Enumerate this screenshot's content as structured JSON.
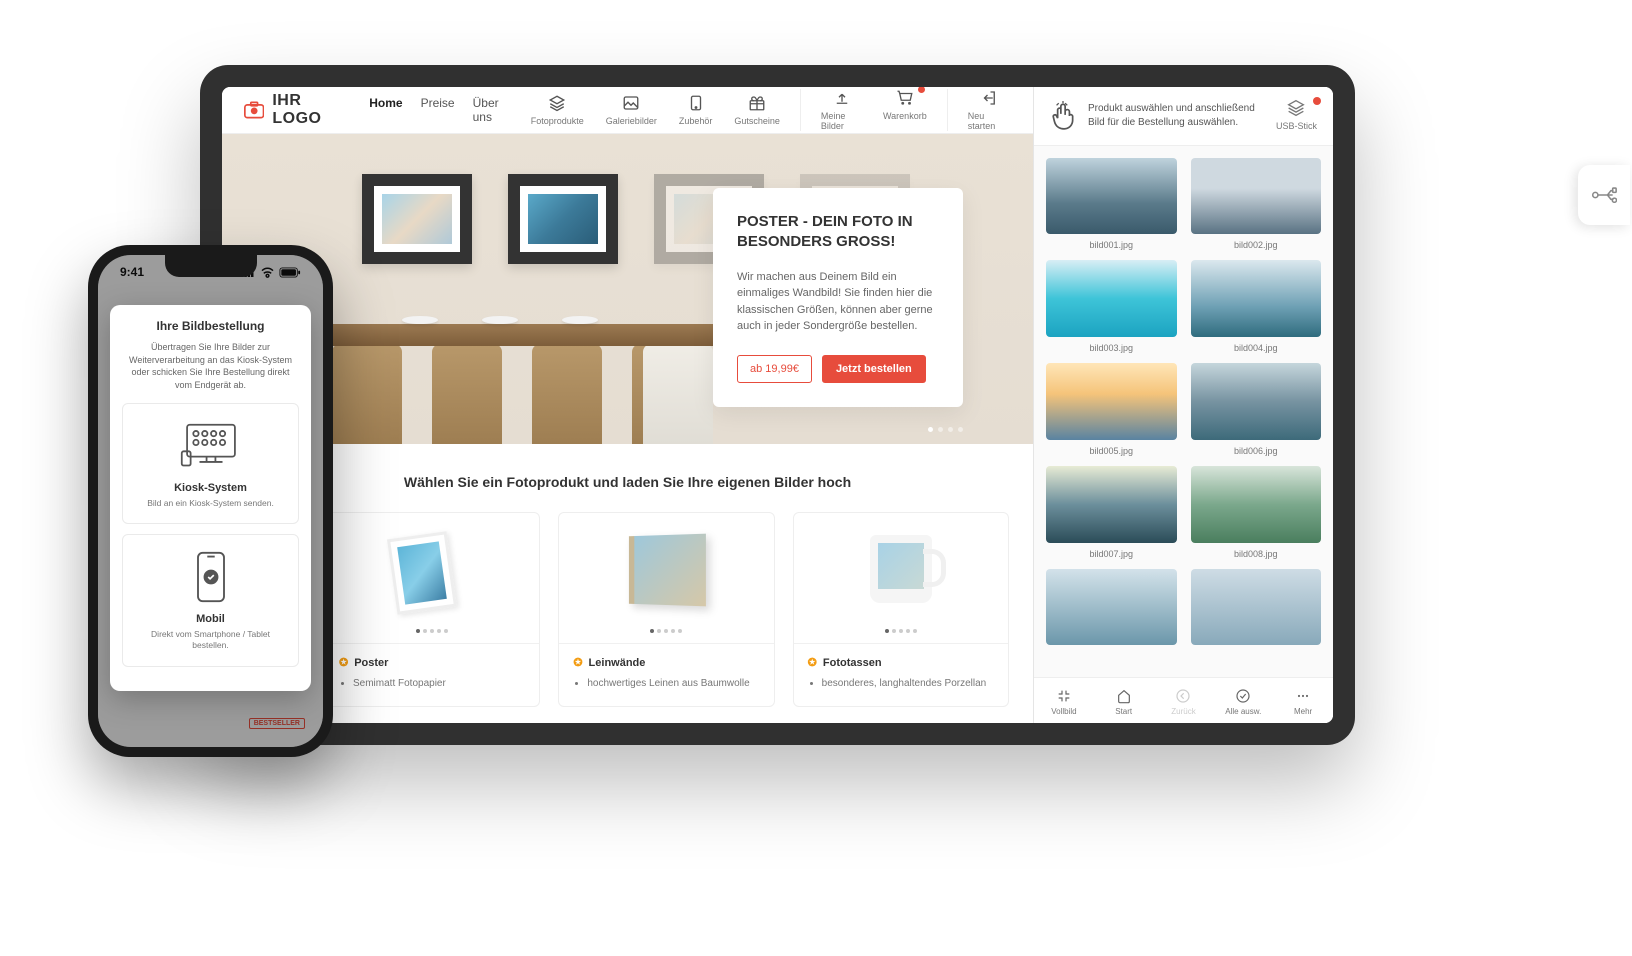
{
  "tablet": {
    "logo": "IHR LOGO",
    "nav": {
      "home": "Home",
      "preise": "Preise",
      "ueber": "Über uns"
    },
    "icons": {
      "fotoprodukte": "Fotoprodukte",
      "galeriebilder": "Galeriebilder",
      "zubehoer": "Zubehör",
      "gutscheine": "Gutscheine",
      "meinebilder": "Meine Bilder",
      "warenkorb": "Warenkorb",
      "neustarten": "Neu starten"
    },
    "hero": {
      "title": "POSTER - DEIN FOTO IN BESONDERS GROSS!",
      "text": "Wir machen aus Deinem Bild ein einmaliges Wandbild! Sie finden hier die klassischen Größen, können aber gerne auch in jeder Sondergröße bestellen.",
      "price_btn": "ab 19,99€",
      "order_btn": "Jetzt bestellen"
    },
    "section_title": "Wählen Sie ein Fotoprodukt und laden Sie Ihre eigenen Bilder hoch",
    "bestseller": "BESTSELLER",
    "products": {
      "poster": {
        "title": "Poster",
        "bullet1": "Semimatt Fotopapier"
      },
      "leinwand": {
        "title": "Leinwände",
        "bullet1": "hochwertiges Leinen aus Baumwolle"
      },
      "fototassen": {
        "title": "Fototassen",
        "bullet1": "besonderes, langhaltendes Porzellan"
      }
    },
    "sidebar": {
      "msg": "Produkt auswählen und anschließend Bild für die Bestellung auswählen.",
      "usb": "USB-Stick",
      "images": [
        {
          "name": "bild001.jpg",
          "bg": "linear-gradient(#bfd3dd,#5a7a8a 60%,#3a5a6b)"
        },
        {
          "name": "bild002.jpg",
          "bg": "linear-gradient(#cfd9e0 40%,#597283)"
        },
        {
          "name": "bild003.jpg",
          "bg": "linear-gradient(#d8eef5,#3ec4d8 50%,#1ba3c1)"
        },
        {
          "name": "bild004.jpg",
          "bg": "linear-gradient(#dbe8ee,#6fa1b5 60%,#2f6c7e)"
        },
        {
          "name": "bild005.jpg",
          "bg": "linear-gradient(#ffe6b8,#f5c47a 40%,#5983a1)"
        },
        {
          "name": "bild006.jpg",
          "bg": "linear-gradient(#c5d6dc,#7793a1 50%,#3d6a7a)"
        },
        {
          "name": "bild007.jpg",
          "bg": "linear-gradient(#e7ebd5,#6c8f9c 50%,#2b4c58)"
        },
        {
          "name": "bild008.jpg",
          "bg": "linear-gradient(#d8e5da,#7ba88c 50%,#4a7e5e)"
        },
        {
          "name": "",
          "bg": "linear-gradient(#d3e2ea,#6b97aa)"
        },
        {
          "name": "",
          "bg": "linear-gradient(#cedce5,#88a9ba)"
        }
      ],
      "bottom": {
        "vollbild": "Vollbild",
        "start": "Start",
        "zurueck": "Zurück",
        "alleausw": "Alle ausw.",
        "mehr": "Mehr"
      }
    }
  },
  "phone": {
    "time": "9:41",
    "modal": {
      "title": "Ihre Bildbestellung",
      "subtitle": "Übertragen Sie Ihre Bilder zur Weiterverarbeitung an das Kiosk-System oder schicken Sie Ihre Bestellung direkt vom Endgerät ab.",
      "opt1": {
        "title": "Kiosk-System",
        "desc": "Bild an ein Kiosk-System senden."
      },
      "opt2": {
        "title": "Mobil",
        "desc": "Direkt vom Smartphone / Tablet bestellen."
      }
    },
    "bg_section": "Ihre eigenen Bilder hoch",
    "bg_bestseller": "BESTSELLER"
  }
}
